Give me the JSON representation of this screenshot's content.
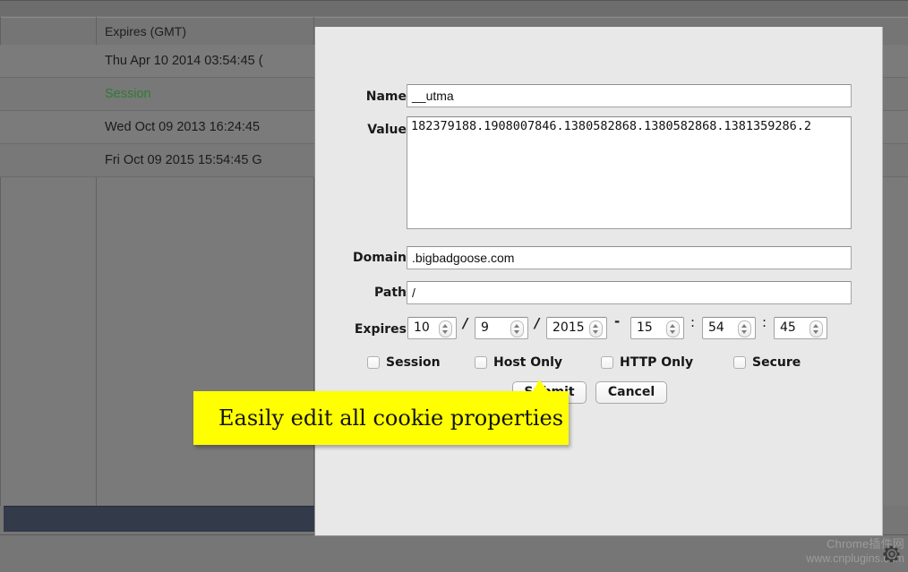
{
  "table": {
    "columns": [
      "",
      "Expires (GMT)"
    ],
    "rows": [
      {
        "expires": "Thu Apr 10 2014 03:54:45 (",
        "session": false
      },
      {
        "expires": "Session",
        "session": true
      },
      {
        "expires": "Wed Oct 09 2013 16:24:45",
        "session": false
      },
      {
        "expires": "Fri Oct 09 2015 15:54:45 G",
        "session": false
      }
    ]
  },
  "form": {
    "name": {
      "label": "Name",
      "value": "__utma"
    },
    "value": {
      "label": "Value",
      "value": "182379188.1908007846.1380582868.1380582868.1381359286.2"
    },
    "domain": {
      "label": "Domain",
      "value": ".bigbadgoose.com"
    },
    "path": {
      "label": "Path",
      "value": "/"
    },
    "expires": {
      "label": "Expires",
      "month": "10",
      "day": "9",
      "year": "2015",
      "hour": "15",
      "minute": "54",
      "second": "45",
      "date_separator": "/",
      "datetime_separator": "-",
      "time_separator": ":"
    },
    "checkboxes": [
      {
        "label": "Session",
        "checked": false
      },
      {
        "label": "Host Only",
        "checked": false
      },
      {
        "label": "HTTP Only",
        "checked": false
      },
      {
        "label": "Secure",
        "checked": false
      }
    ],
    "submit_label": "Submit",
    "cancel_label": "Cancel"
  },
  "callout": {
    "text": "Easily edit all cookie properties",
    "color": "#ffff00"
  },
  "watermark": {
    "line1": "Chrome插件网",
    "line2": "www.cnplugins.com",
    "icon": "gear-icon"
  },
  "colors": {
    "page_bg": "#767676",
    "panel_bg": "#e8e8e8",
    "header_bg": "#757575",
    "session_green": "#2e7d32",
    "dark_bar": "#333a4a"
  }
}
